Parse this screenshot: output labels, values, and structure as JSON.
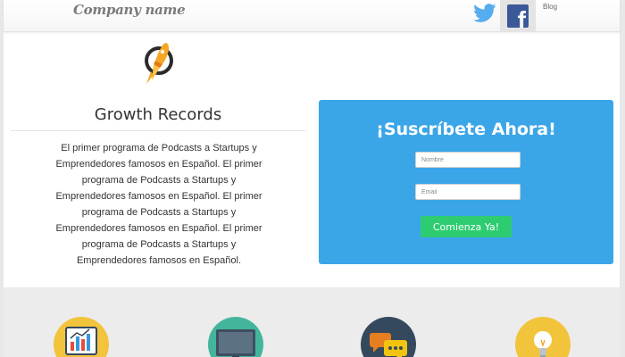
{
  "header": {
    "company_name": "Company name",
    "social": [
      "twitter-icon",
      "facebook-icon"
    ],
    "blog_label": "Blog"
  },
  "intro": {
    "logo_icon": "rocket-icon",
    "title": "Growth Records",
    "description": "El primer programa de Podcasts a Startups y Emprendedores famosos en Español. El primer programa de Podcasts a Startups y Emprendedores famosos en Español. El primer programa de Podcasts a Startups y Emprendedores famosos en Español. El primer programa de Podcasts a Startups y Emprendedores famosos en Español."
  },
  "subscribe": {
    "title": "¡Suscríbete Ahora!",
    "name_placeholder": "Nombre",
    "email_placeholder": "Email",
    "button_label": "Comienza Ya!"
  },
  "features": {
    "icons": [
      "chart-board-icon",
      "monitor-icon",
      "chat-bubbles-icon",
      "lightbulb-icon"
    ]
  },
  "colors": {
    "subscribe_bg": "#3aa6e8",
    "cta_bg": "#2ecc71",
    "twitter": "#55acee",
    "facebook": "#3b5998"
  }
}
